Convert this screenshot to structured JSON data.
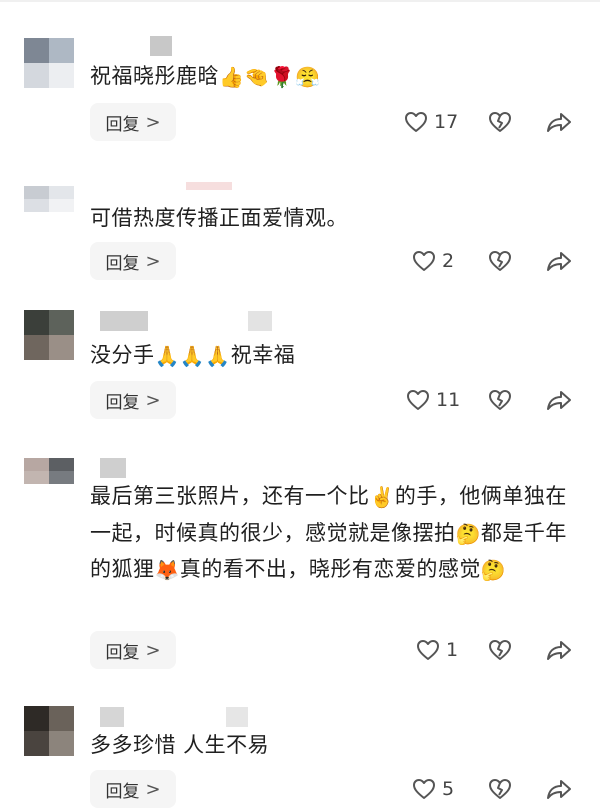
{
  "reply_label": "回复",
  "reply_chevron": ">",
  "colors": {
    "icon": "#555555",
    "reply_bg": "#f5f5f5"
  },
  "comments": [
    {
      "text": "祝福晓彤鹿晗",
      "emoji": [
        "👍",
        "🤏",
        "🌹",
        "😤"
      ],
      "likes": "17"
    },
    {
      "text": "可借热度传播正面爱情观。",
      "likes": "2"
    },
    {
      "text_before": "没分手",
      "emoji": [
        "🙏",
        "🙏",
        "🙏"
      ],
      "text_after": "祝幸福",
      "likes": "11"
    },
    {
      "seg1": "最后第三张照片，还有一个比",
      "emoji1": "✌️",
      "seg2": "的手，他俩单独在一起，时候真的很少，感觉就是像摆拍",
      "emoji2": "🤔",
      "seg3": "都是千年的狐狸",
      "emoji3": "🦊",
      "seg4": "真的看不出，晓彤有恋爱的感觉",
      "emoji4": "🤔",
      "likes": "1"
    },
    {
      "text": "多多珍惜 人生不易",
      "likes": "5"
    }
  ]
}
